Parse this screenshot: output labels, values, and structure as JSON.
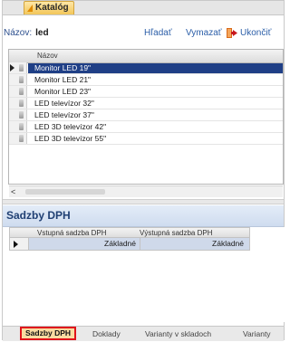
{
  "document_tab": {
    "label": "Katalóg"
  },
  "filter": {
    "label": "Názov:",
    "value": "led"
  },
  "toolbar": {
    "search": "Hľadať",
    "clear": "Vymazať",
    "close": "Ukončiť"
  },
  "products": {
    "column": "Názov",
    "selected_index": 0,
    "rows": [
      "Monitor LED 19\"",
      "Monitor LED 21\"",
      "Monitor LED 23\"",
      "LED televízor 32\"",
      "LED televízor 37\"",
      "LED 3D televízor 42\"",
      "LED 3D televízor 55\""
    ]
  },
  "scroll": {
    "left_arrow": "<"
  },
  "vat": {
    "title": "Sadzby DPH",
    "columns": [
      "Vstupná sadzba DPH",
      "Výstupná sadzba DPH"
    ],
    "row": [
      "Základné",
      "Základné"
    ]
  },
  "bottom_tabs": [
    {
      "label": "Sadzby DPH",
      "active": true
    },
    {
      "label": "Doklady",
      "active": false
    },
    {
      "label": "Varianty v skladoch",
      "active": false
    },
    {
      "label": "Varianty",
      "active": false
    }
  ],
  "colors": {
    "selection": "#1f3f86",
    "active_tab_border": "#e0121b",
    "panel_title": "#1f3f73"
  }
}
